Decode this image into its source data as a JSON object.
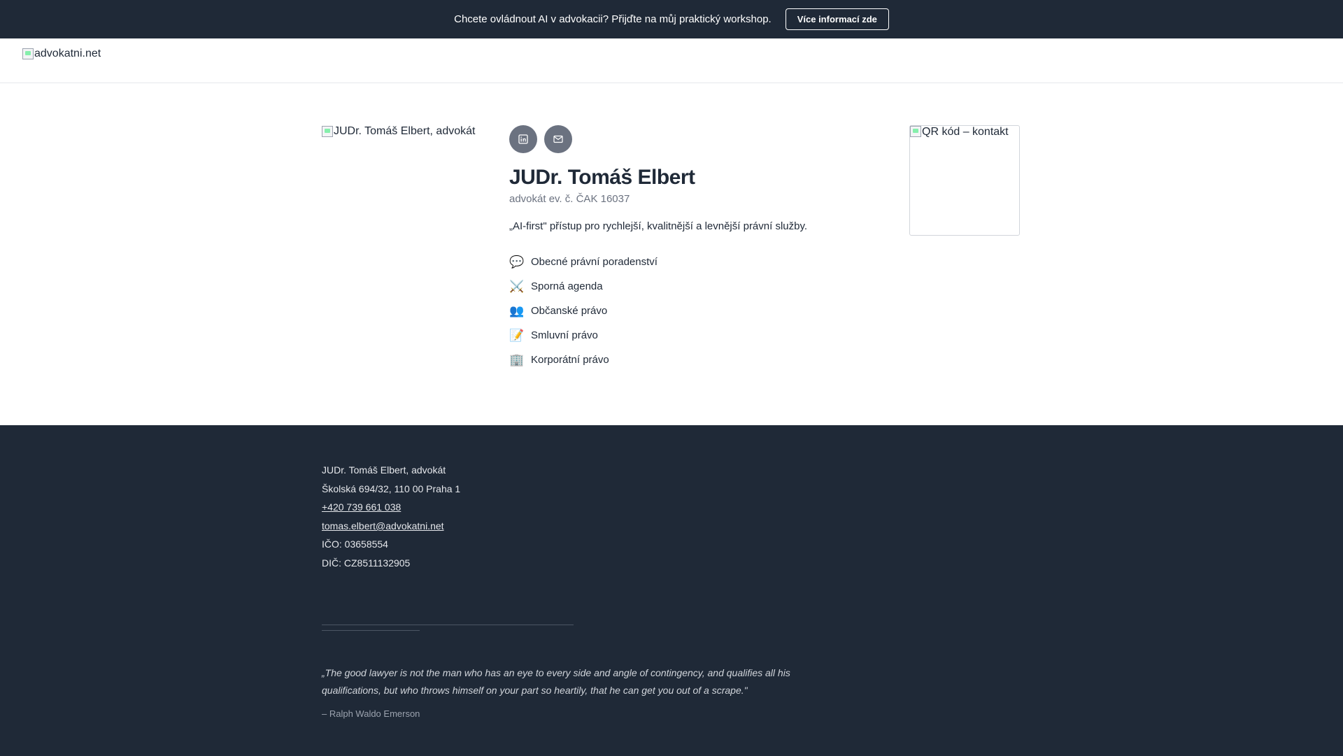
{
  "announcement": {
    "text": "Chcete ovládnout AI v advokacii? Přijďte na můj praktický workshop.",
    "button": "Více informací zde"
  },
  "header": {
    "logo_alt": "advokatni.net"
  },
  "profile": {
    "photo_alt": "JUDr. Tomáš Elbert, advokát",
    "name": "JUDr. Tomáš Elbert",
    "subtitle": "advokát ev. č. ČAK 16037",
    "tagline": "„AI-first\" přístup pro rychlejší, kvalitnější a levnější právní služby.",
    "social": [
      {
        "icon": "linkedin-icon"
      },
      {
        "icon": "mail-icon"
      }
    ],
    "services": [
      {
        "icon": "💬",
        "label": "Obecné právní poradenství"
      },
      {
        "icon": "⚔️",
        "label": "Sporná agenda"
      },
      {
        "icon": "👥",
        "label": "Občanské právo"
      },
      {
        "icon": "📝",
        "label": "Smluvní právo"
      },
      {
        "icon": "🏢",
        "label": "Korporátní právo"
      }
    ],
    "qr_alt": "QR kód – kontakt"
  },
  "footer": {
    "name": "JUDr. Tomáš Elbert, advokát",
    "address": "Školská 694/32, 110 00 Praha 1",
    "phone": "+420 739 661 038",
    "email": "tomas.elbert@advokatni.net",
    "ico": "IČO: 03658554",
    "dic": "DIČ: CZ8511132905",
    "quote": "„The good lawyer is not the man who has an eye to every side and angle of contingency, and qualifies all his qualifications, but who throws himself on your part so heartily, that he can get you out of a scrape.\"",
    "author": "– Ralph Waldo Emerson"
  },
  "colors": {
    "dark": "#1f2937",
    "muted": "#6b7280",
    "border": "#e5e7eb"
  }
}
